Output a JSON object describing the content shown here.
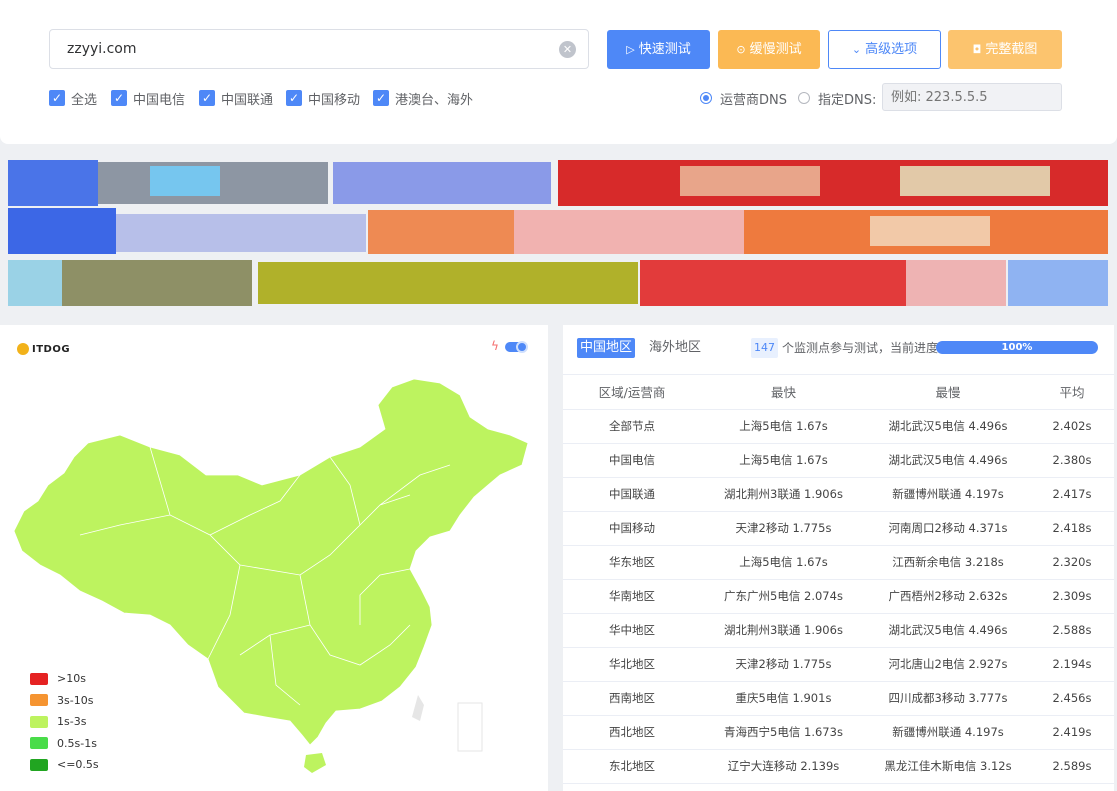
{
  "search": {
    "url_value": "zzyyi.com",
    "clear_icon": "clear-circle-icon"
  },
  "buttons": {
    "fast_test": "快速测试",
    "slow_test": "缓慢测试",
    "advanced": "高级选项",
    "screenshot": "完整截图"
  },
  "checkboxes": [
    {
      "label": "全选",
      "checked": true
    },
    {
      "label": "中国电信",
      "checked": true
    },
    {
      "label": "中国联通",
      "checked": true
    },
    {
      "label": "中国移动",
      "checked": true
    },
    {
      "label": "港澳台、海外",
      "checked": true
    }
  ],
  "dns": {
    "isp_dns_label": "运营商DNS",
    "isp_dns_selected": true,
    "custom_dns_label": "指定DNS:",
    "custom_dns_placeholder": "例如: 223.5.5.5"
  },
  "map": {
    "logo_text": "ITDOG",
    "fill_color": "#bdf35f",
    "legend": [
      {
        "label": ">10s",
        "color": "#e52222"
      },
      {
        "label": "3s-10s",
        "color": "#f59431"
      },
      {
        "label": "1s-3s",
        "color": "#bdf35f"
      },
      {
        "label": "0.5s-1s",
        "color": "#49dc49"
      },
      {
        "label": "<=0.5s",
        "color": "#21a521"
      }
    ]
  },
  "results": {
    "tabs": [
      "中国地区",
      "海外地区"
    ],
    "active_tab": "中国地区",
    "node_count": "147",
    "count_text": "个监测点参与测试，当前进度:",
    "progress": 1.0,
    "progress_label": "100%",
    "headers": [
      "区域/运营商",
      "最快",
      "最慢",
      "平均"
    ],
    "rows": [
      [
        "全部节点",
        "上海5电信 1.67s",
        "湖北武汉5电信 4.496s",
        "2.402s"
      ],
      [
        "中国电信",
        "上海5电信 1.67s",
        "湖北武汉5电信 4.496s",
        "2.380s"
      ],
      [
        "中国联通",
        "湖北荆州3联通 1.906s",
        "新疆博州联通 4.197s",
        "2.417s"
      ],
      [
        "中国移动",
        "天津2移动 1.775s",
        "河南周口2移动 4.371s",
        "2.418s"
      ],
      [
        "华东地区",
        "上海5电信 1.67s",
        "江西新余电信 3.218s",
        "2.320s"
      ],
      [
        "华南地区",
        "广东广州5电信 2.074s",
        "广西梧州2移动 2.632s",
        "2.309s"
      ],
      [
        "华中地区",
        "湖北荆州3联通 1.906s",
        "湖北武汉5电信 4.496s",
        "2.588s"
      ],
      [
        "华北地区",
        "天津2移动 1.775s",
        "河北唐山2电信 2.927s",
        "2.194s"
      ],
      [
        "西南地区",
        "重庆5电信 1.901s",
        "四川成都3移动 3.777s",
        "2.456s"
      ],
      [
        "西北地区",
        "青海西宁5电信 1.673s",
        "新疆博州联通 4.197s",
        "2.419s"
      ],
      [
        "东北地区",
        "辽宁大连移动 2.139s",
        "黑龙江佳木斯电信 3.12s",
        "2.589s"
      ]
    ]
  },
  "colors": {
    "primary": "#4e88f7",
    "warning": "#fbb954"
  }
}
